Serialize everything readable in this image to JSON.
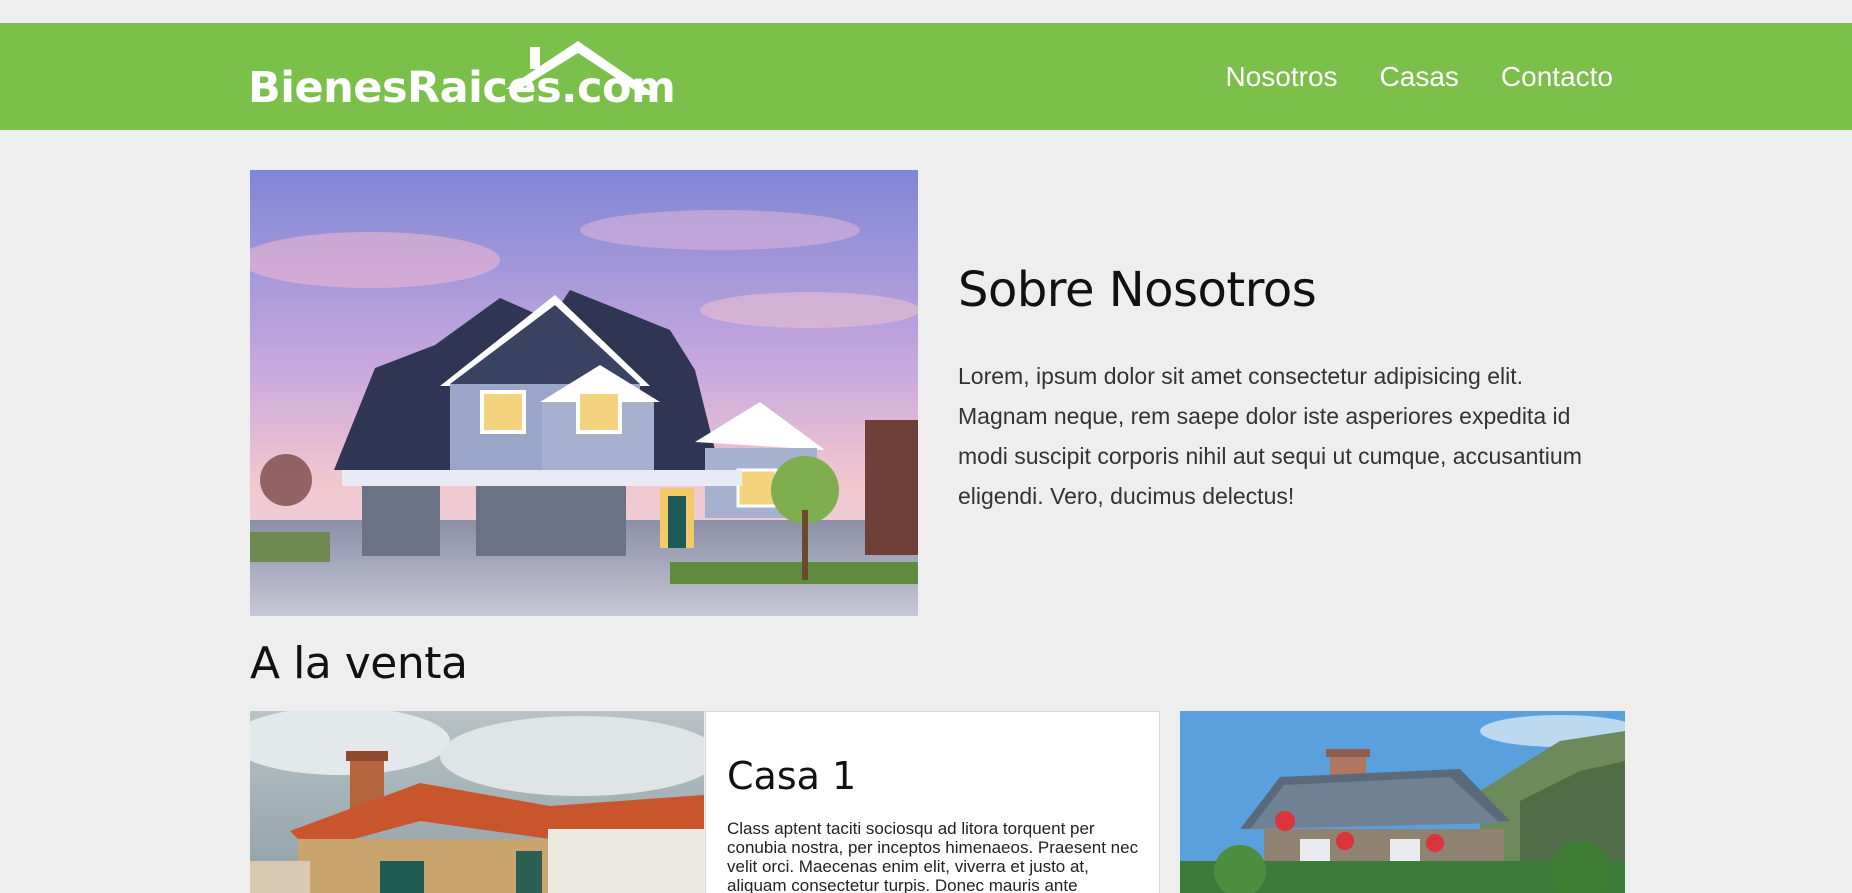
{
  "header": {
    "logo_text": "BienesRaices.com",
    "nav": [
      {
        "label": "Nosotros"
      },
      {
        "label": "Casas"
      },
      {
        "label": "Contacto"
      }
    ]
  },
  "about": {
    "title": "Sobre Nosotros",
    "body": "Lorem, ipsum dolor sit amet consectetur adipisicing elit. Magnam neque, rem saepe dolor iste asperiores expedita id modi suscipit corporis nihil aut sequi ut cumque, accusantium eligendi. Vero, ducimus delectus!"
  },
  "sale": {
    "title": "A la venta",
    "cards": [
      {
        "title": "Casa 1",
        "body": "Class aptent taciti sociosqu ad litora torquent per conubia nostra, per inceptos himenaeos. Praesent nec velit orci. Maecenas enim elit, viverra et justo at, aliquam consectetur turpis. Donec mauris ante"
      }
    ]
  },
  "colors": {
    "brand_green": "#7bc04b",
    "page_bg": "#eeeeee"
  }
}
